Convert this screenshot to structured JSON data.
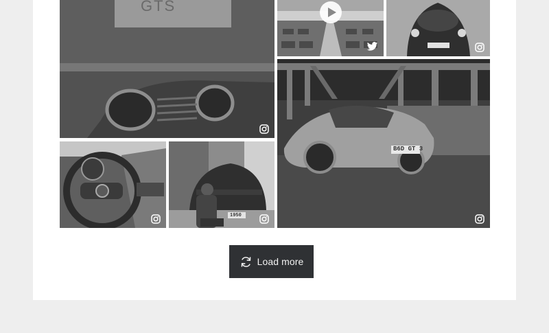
{
  "gallery": {
    "tiles": [
      {
        "id": "exhaust-closeup",
        "plate_text": "GTS",
        "source_icon": "instagram-icon"
      },
      {
        "id": "video-parking-garage",
        "source_icon": "twitter-icon",
        "has_play_button": true
      },
      {
        "id": "car-rear-dark",
        "source_icon": "instagram-icon"
      },
      {
        "id": "gt3-touring-night",
        "plate_text": "B6D GT 3",
        "source_icon": "instagram-icon"
      },
      {
        "id": "steering-wheel",
        "source_icon": "instagram-icon"
      },
      {
        "id": "car-with-model",
        "plate_text": "1950",
        "source_icon": "instagram-icon"
      }
    ]
  },
  "load_more": {
    "label": "Load more",
    "icon": "refresh-icon"
  },
  "colors": {
    "page_bg": "#eeeeee",
    "panel_bg": "#ffffff",
    "button_bg": "#2f3134",
    "button_text": "#f1f1f1"
  }
}
